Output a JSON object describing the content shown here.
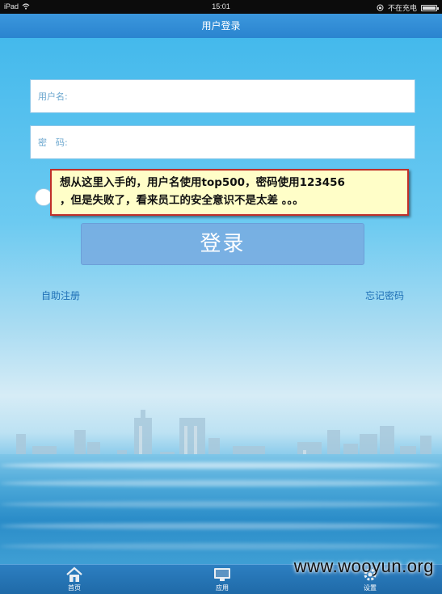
{
  "status_bar": {
    "device": "iPad",
    "time": "15:01",
    "charging": "不在充电"
  },
  "nav": {
    "title": "用户登录"
  },
  "form": {
    "username_label": "用户名:",
    "password_label": "密　码:",
    "login_label": "登录"
  },
  "annotation": {
    "line1": "想从这里入手的，用户名使用top500，密码使用123456",
    "line2": "，但是失败了，看来员工的安全意识不是太差 。。。"
  },
  "links": {
    "register": "自助注册",
    "forgot": "忘记密码"
  },
  "tabs": [
    {
      "label": "首页",
      "icon": "home-icon"
    },
    {
      "label": "应用",
      "icon": "monitor-icon"
    },
    {
      "label": "设置",
      "icon": "gear-icon"
    }
  ],
  "watermark": "www.wooyun.org"
}
